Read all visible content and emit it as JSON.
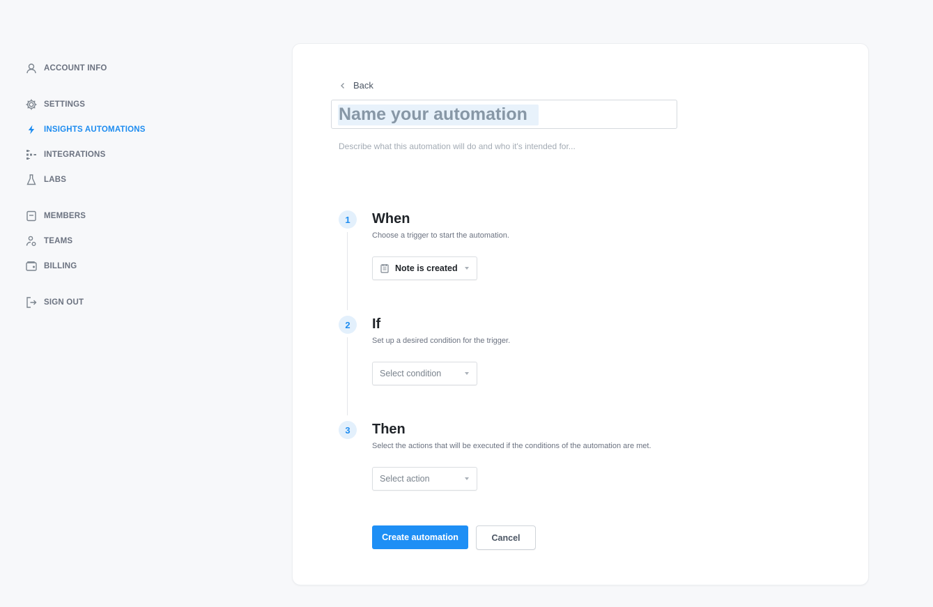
{
  "sidebar": {
    "items": [
      {
        "label": "ACCOUNT INFO",
        "icon": "user-icon"
      },
      {
        "label": "SETTINGS",
        "icon": "gear-icon"
      },
      {
        "label": "INSIGHTS AUTOMATIONS",
        "icon": "bolt-icon",
        "active": true
      },
      {
        "label": "INTEGRATIONS",
        "icon": "integrations-icon"
      },
      {
        "label": "LABS",
        "icon": "flask-icon"
      },
      {
        "label": "MEMBERS",
        "icon": "members-icon"
      },
      {
        "label": "TEAMS",
        "icon": "teams-icon"
      },
      {
        "label": "BILLING",
        "icon": "wallet-icon"
      },
      {
        "label": "SIGN OUT",
        "icon": "sign-out-icon"
      }
    ]
  },
  "form": {
    "back_label": "Back",
    "name_placeholder": "Name your automation",
    "description_placeholder": "Describe what this automation will do and who it's intended for..."
  },
  "steps": [
    {
      "number": "1",
      "title": "When",
      "subtitle": "Choose a trigger to start the automation.",
      "dropdown": "Note is created"
    },
    {
      "number": "2",
      "title": "If",
      "subtitle": "Set up a desired condition for the trigger.",
      "dropdown": "Select condition"
    },
    {
      "number": "3",
      "title": "Then",
      "subtitle": "Select the actions that will be executed if the conditions of the automation are met.",
      "dropdown": "Select action"
    }
  ],
  "actions": {
    "create_label": "Create automation",
    "cancel_label": "Cancel"
  },
  "colors": {
    "accent": "#1e8ff5",
    "background": "#f7f8fa",
    "step_badge_bg": "#e3f0fc"
  }
}
